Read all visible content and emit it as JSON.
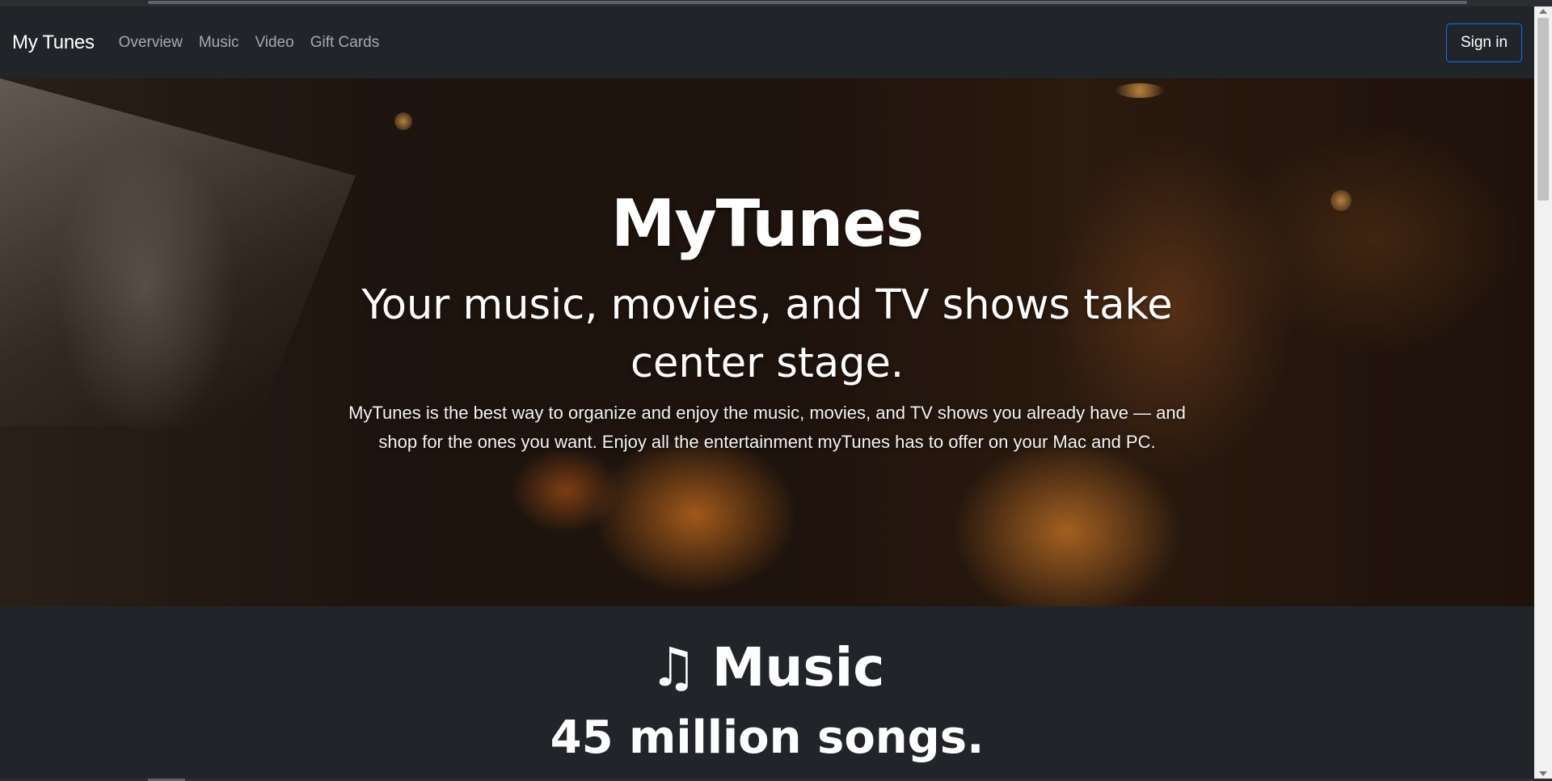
{
  "navbar": {
    "brand": "My Tunes",
    "links": [
      "Overview",
      "Music",
      "Video",
      "Gift Cards"
    ],
    "signin_label": "Sign in"
  },
  "hero": {
    "title": "MyTunes",
    "subtitle": "Your music, movies, and TV shows take center stage.",
    "text": "MyTunes is the best way to organize and enjoy the music, movies, and TV shows you already have — and shop for the ones you want. Enjoy all the entertainment myTunes has to offer on your Mac and PC."
  },
  "music": {
    "icon": "music-note-icon",
    "heading": "Music",
    "subheading": "45 million songs."
  },
  "colors": {
    "background": "#212529",
    "signin_border": "#0d6efd",
    "nav_link": "rgba(255,255,255,0.6)"
  }
}
